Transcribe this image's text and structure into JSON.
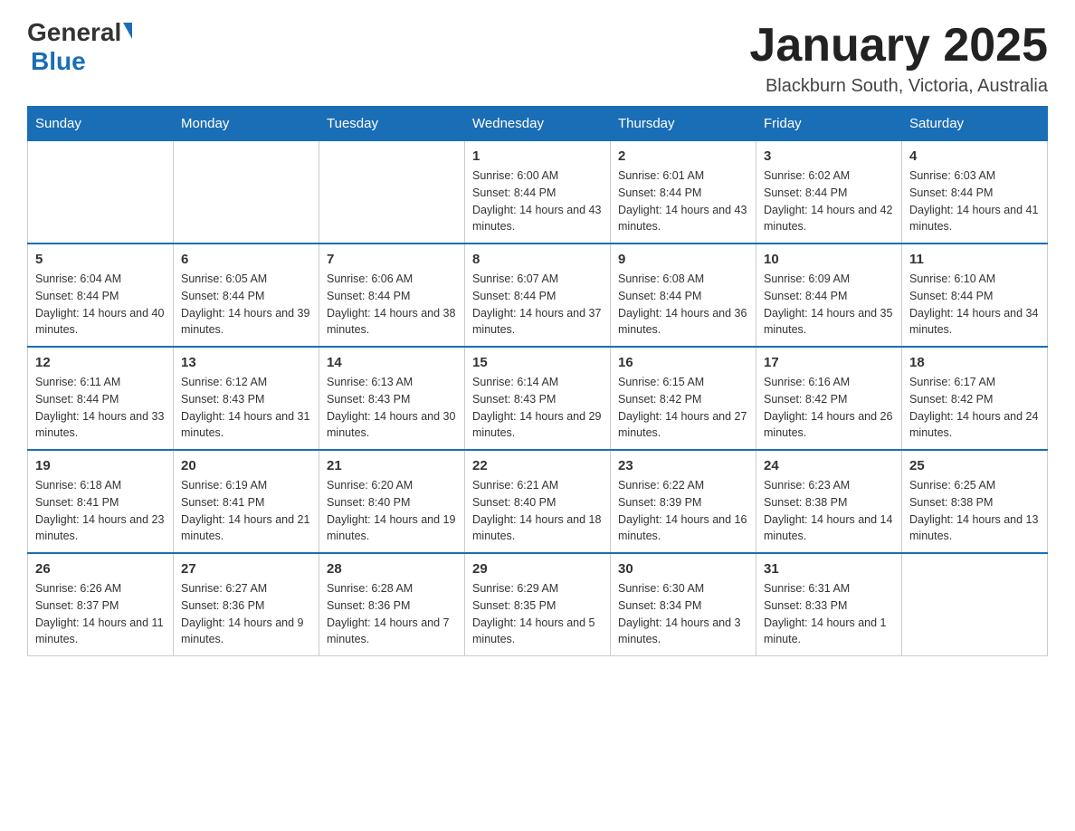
{
  "header": {
    "logo_general": "General",
    "logo_blue": "Blue",
    "month_title": "January 2025",
    "location": "Blackburn South, Victoria, Australia"
  },
  "days_of_week": [
    "Sunday",
    "Monday",
    "Tuesday",
    "Wednesday",
    "Thursday",
    "Friday",
    "Saturday"
  ],
  "weeks": [
    [
      {
        "day": "",
        "info": ""
      },
      {
        "day": "",
        "info": ""
      },
      {
        "day": "",
        "info": ""
      },
      {
        "day": "1",
        "info": "Sunrise: 6:00 AM\nSunset: 8:44 PM\nDaylight: 14 hours and 43 minutes."
      },
      {
        "day": "2",
        "info": "Sunrise: 6:01 AM\nSunset: 8:44 PM\nDaylight: 14 hours and 43 minutes."
      },
      {
        "day": "3",
        "info": "Sunrise: 6:02 AM\nSunset: 8:44 PM\nDaylight: 14 hours and 42 minutes."
      },
      {
        "day": "4",
        "info": "Sunrise: 6:03 AM\nSunset: 8:44 PM\nDaylight: 14 hours and 41 minutes."
      }
    ],
    [
      {
        "day": "5",
        "info": "Sunrise: 6:04 AM\nSunset: 8:44 PM\nDaylight: 14 hours and 40 minutes."
      },
      {
        "day": "6",
        "info": "Sunrise: 6:05 AM\nSunset: 8:44 PM\nDaylight: 14 hours and 39 minutes."
      },
      {
        "day": "7",
        "info": "Sunrise: 6:06 AM\nSunset: 8:44 PM\nDaylight: 14 hours and 38 minutes."
      },
      {
        "day": "8",
        "info": "Sunrise: 6:07 AM\nSunset: 8:44 PM\nDaylight: 14 hours and 37 minutes."
      },
      {
        "day": "9",
        "info": "Sunrise: 6:08 AM\nSunset: 8:44 PM\nDaylight: 14 hours and 36 minutes."
      },
      {
        "day": "10",
        "info": "Sunrise: 6:09 AM\nSunset: 8:44 PM\nDaylight: 14 hours and 35 minutes."
      },
      {
        "day": "11",
        "info": "Sunrise: 6:10 AM\nSunset: 8:44 PM\nDaylight: 14 hours and 34 minutes."
      }
    ],
    [
      {
        "day": "12",
        "info": "Sunrise: 6:11 AM\nSunset: 8:44 PM\nDaylight: 14 hours and 33 minutes."
      },
      {
        "day": "13",
        "info": "Sunrise: 6:12 AM\nSunset: 8:43 PM\nDaylight: 14 hours and 31 minutes."
      },
      {
        "day": "14",
        "info": "Sunrise: 6:13 AM\nSunset: 8:43 PM\nDaylight: 14 hours and 30 minutes."
      },
      {
        "day": "15",
        "info": "Sunrise: 6:14 AM\nSunset: 8:43 PM\nDaylight: 14 hours and 29 minutes."
      },
      {
        "day": "16",
        "info": "Sunrise: 6:15 AM\nSunset: 8:42 PM\nDaylight: 14 hours and 27 minutes."
      },
      {
        "day": "17",
        "info": "Sunrise: 6:16 AM\nSunset: 8:42 PM\nDaylight: 14 hours and 26 minutes."
      },
      {
        "day": "18",
        "info": "Sunrise: 6:17 AM\nSunset: 8:42 PM\nDaylight: 14 hours and 24 minutes."
      }
    ],
    [
      {
        "day": "19",
        "info": "Sunrise: 6:18 AM\nSunset: 8:41 PM\nDaylight: 14 hours and 23 minutes."
      },
      {
        "day": "20",
        "info": "Sunrise: 6:19 AM\nSunset: 8:41 PM\nDaylight: 14 hours and 21 minutes."
      },
      {
        "day": "21",
        "info": "Sunrise: 6:20 AM\nSunset: 8:40 PM\nDaylight: 14 hours and 19 minutes."
      },
      {
        "day": "22",
        "info": "Sunrise: 6:21 AM\nSunset: 8:40 PM\nDaylight: 14 hours and 18 minutes."
      },
      {
        "day": "23",
        "info": "Sunrise: 6:22 AM\nSunset: 8:39 PM\nDaylight: 14 hours and 16 minutes."
      },
      {
        "day": "24",
        "info": "Sunrise: 6:23 AM\nSunset: 8:38 PM\nDaylight: 14 hours and 14 minutes."
      },
      {
        "day": "25",
        "info": "Sunrise: 6:25 AM\nSunset: 8:38 PM\nDaylight: 14 hours and 13 minutes."
      }
    ],
    [
      {
        "day": "26",
        "info": "Sunrise: 6:26 AM\nSunset: 8:37 PM\nDaylight: 14 hours and 11 minutes."
      },
      {
        "day": "27",
        "info": "Sunrise: 6:27 AM\nSunset: 8:36 PM\nDaylight: 14 hours and 9 minutes."
      },
      {
        "day": "28",
        "info": "Sunrise: 6:28 AM\nSunset: 8:36 PM\nDaylight: 14 hours and 7 minutes."
      },
      {
        "day": "29",
        "info": "Sunrise: 6:29 AM\nSunset: 8:35 PM\nDaylight: 14 hours and 5 minutes."
      },
      {
        "day": "30",
        "info": "Sunrise: 6:30 AM\nSunset: 8:34 PM\nDaylight: 14 hours and 3 minutes."
      },
      {
        "day": "31",
        "info": "Sunrise: 6:31 AM\nSunset: 8:33 PM\nDaylight: 14 hours and 1 minute."
      },
      {
        "day": "",
        "info": ""
      }
    ]
  ]
}
